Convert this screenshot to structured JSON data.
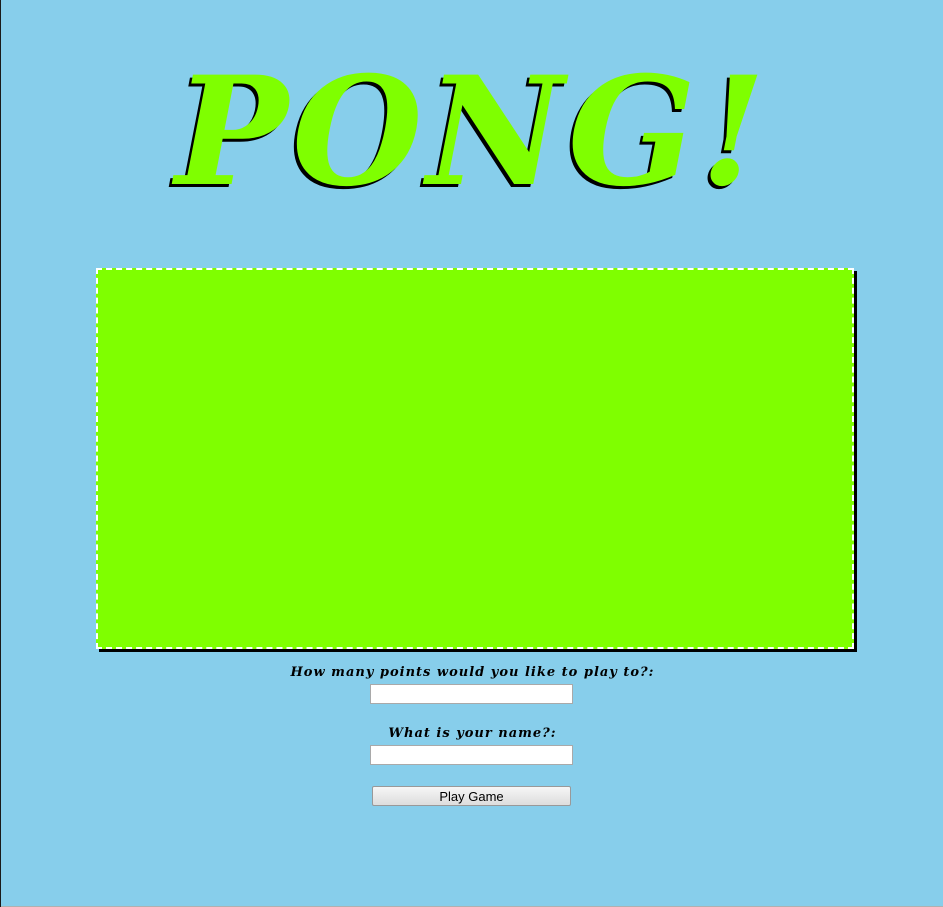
{
  "title": "PONG!",
  "colors": {
    "background": "#87ceeb",
    "accent": "#7fff00",
    "canvas_border": "#ffffff",
    "shadow": "#000000"
  },
  "form": {
    "points_label": "How many points would you like to play to?:",
    "points_value": "",
    "name_label": "What is your name?:",
    "name_value": "",
    "play_button_label": "Play Game"
  }
}
